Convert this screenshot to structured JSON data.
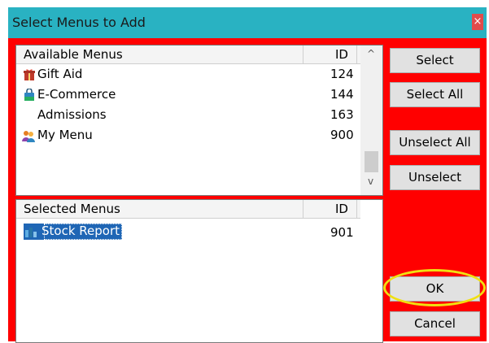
{
  "dialog": {
    "title": "Select Menus to Add",
    "close_glyph": "×"
  },
  "available": {
    "header_name": "Available Menus",
    "header_id": "ID",
    "items": [
      {
        "name": "Gift Aid",
        "id": "124",
        "icon": "gift-icon"
      },
      {
        "name": "E-Commerce",
        "id": "144",
        "icon": "shopping-bag-icon"
      },
      {
        "name": "Admissions",
        "id": "163",
        "icon": ""
      },
      {
        "name": "My Menu",
        "id": "900",
        "icon": "user-group-icon"
      }
    ],
    "scroll_up": "^",
    "scroll_down": "v",
    "scroll_left": "<",
    "scroll_right": ">"
  },
  "selected": {
    "header_name": "Selected Menus",
    "header_id": "ID",
    "items": [
      {
        "name": "Stock Report",
        "id": "901",
        "icon": "report-icon",
        "selected": true
      }
    ]
  },
  "buttons": {
    "select": "Select",
    "select_all": "Select All",
    "unselect_all": "Unselect All",
    "unselect": "Unselect",
    "ok": "OK",
    "cancel": "Cancel"
  },
  "colors": {
    "dialog_background": "#ff0000",
    "titlebar": "#29b2c2",
    "selection": "#1f66b5",
    "ok_highlight": "#f0e010"
  }
}
